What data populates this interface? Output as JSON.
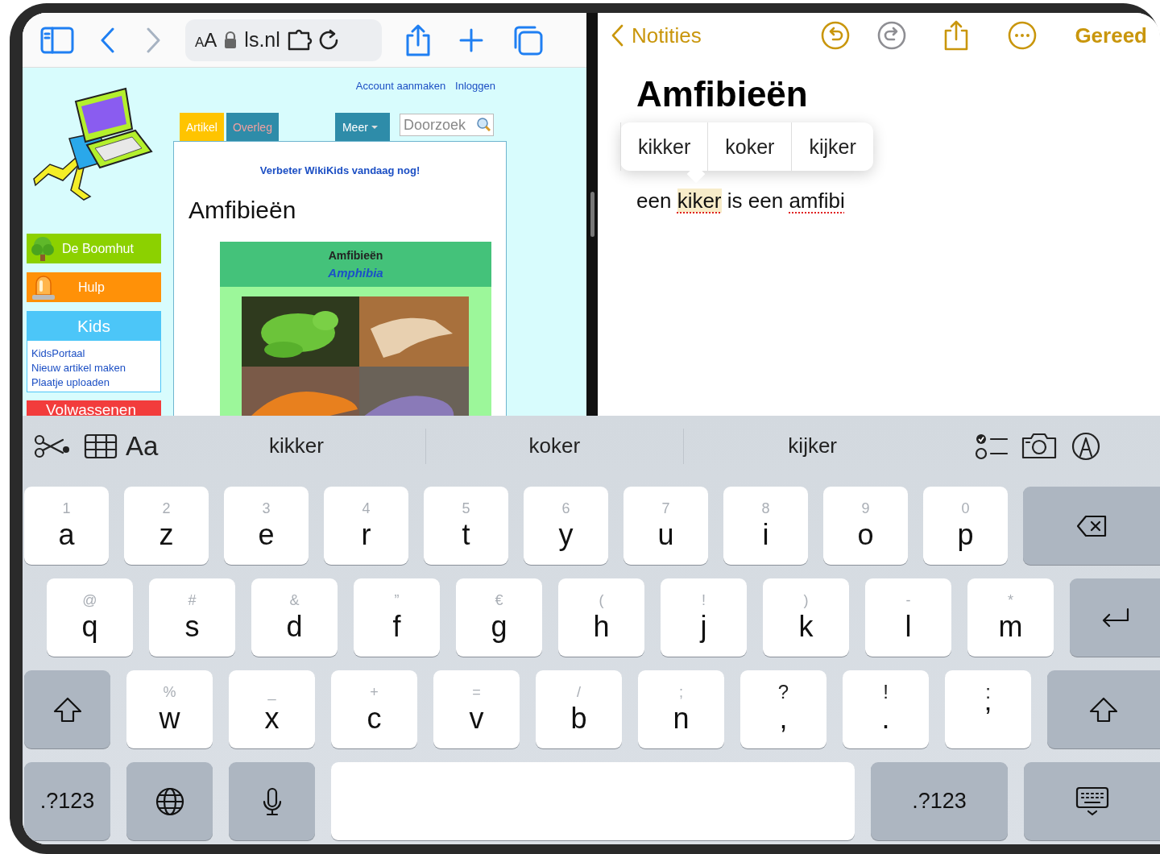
{
  "browser": {
    "toolbar": {
      "back": {
        "disabled": false
      },
      "forward": {
        "disabled": true
      },
      "text_size": "AA",
      "address": "ls.nl"
    },
    "page": {
      "account_links": [
        "Account aanmaken",
        "Inloggen"
      ],
      "tabs": [
        {
          "label": "Artikel",
          "selected": true
        },
        {
          "label": "Overleg",
          "selected": false
        }
      ],
      "more_menu": "Meer",
      "search": {
        "placeholder": "Doorzoek"
      },
      "sidebar": [
        {
          "kind": "button",
          "label": "De Boomhut",
          "color": "#8cd100"
        },
        {
          "kind": "button",
          "label": "Hulp",
          "color": "#ff9108"
        },
        {
          "kind": "box",
          "label": "Kids",
          "color": "#4cc6f8",
          "links": [
            "KidsPortaal",
            "Nieuw artikel maken",
            "Plaatje uploaden"
          ]
        },
        {
          "kind": "button",
          "label": "Volwassenen",
          "color": "#f23c3c"
        }
      ],
      "notice": "Verbeter WikiKids vandaag nog!",
      "heading": "Amfibieën",
      "infobox": {
        "title": "Amfibieën",
        "subtitle": "Amphibia"
      }
    }
  },
  "notes": {
    "back": "Notities",
    "undo": {
      "disabled": false
    },
    "redo": {
      "disabled": true
    },
    "done": "Gereed",
    "title": "Amfibieën",
    "suggestions": [
      "kikker",
      "koker",
      "kijker"
    ],
    "body": [
      {
        "text": "een",
        "misspelled": false,
        "highlighted": false
      },
      {
        "text": "kiker",
        "misspelled": true,
        "highlighted": true
      },
      {
        "text": "is",
        "misspelled": false,
        "highlighted": false
      },
      {
        "text": "een",
        "misspelled": false,
        "highlighted": false
      },
      {
        "text": "amfibi",
        "misspelled": true,
        "highlighted": false
      }
    ]
  },
  "keyboard": {
    "format_button": "Aa",
    "suggestions": [
      "kikker",
      "koker",
      "kijker"
    ],
    "rows": [
      [
        {
          "kind": "letter",
          "label": "a",
          "hint": "1"
        },
        {
          "kind": "letter",
          "label": "z",
          "hint": "2"
        },
        {
          "kind": "letter",
          "label": "e",
          "hint": "3"
        },
        {
          "kind": "letter",
          "label": "r",
          "hint": "4"
        },
        {
          "kind": "letter",
          "label": "t",
          "hint": "5"
        },
        {
          "kind": "letter",
          "label": "y",
          "hint": "6"
        },
        {
          "kind": "letter",
          "label": "u",
          "hint": "7"
        },
        {
          "kind": "letter",
          "label": "i",
          "hint": "8"
        },
        {
          "kind": "letter",
          "label": "o",
          "hint": "9"
        },
        {
          "kind": "letter",
          "label": "p",
          "hint": "0"
        },
        {
          "kind": "delete"
        }
      ],
      [
        {
          "kind": "letter",
          "label": "q",
          "hint": "@"
        },
        {
          "kind": "letter",
          "label": "s",
          "hint": "#"
        },
        {
          "kind": "letter",
          "label": "d",
          "hint": "&"
        },
        {
          "kind": "letter",
          "label": "f",
          "hint": "”"
        },
        {
          "kind": "letter",
          "label": "g",
          "hint": "€"
        },
        {
          "kind": "letter",
          "label": "h",
          "hint": "("
        },
        {
          "kind": "letter",
          "label": "j",
          "hint": "!"
        },
        {
          "kind": "letter",
          "label": "k",
          "hint": ")"
        },
        {
          "kind": "letter",
          "label": "l",
          "hint": "-"
        },
        {
          "kind": "letter",
          "label": "m",
          "hint": "*"
        },
        {
          "kind": "return"
        }
      ],
      [
        {
          "kind": "shift"
        },
        {
          "kind": "letter",
          "label": "w",
          "hint": "%"
        },
        {
          "kind": "letter",
          "label": "x",
          "hint": "_"
        },
        {
          "kind": "letter",
          "label": "c",
          "hint": "+"
        },
        {
          "kind": "letter",
          "label": "v",
          "hint": "="
        },
        {
          "kind": "letter",
          "label": "b",
          "hint": "/"
        },
        {
          "kind": "letter",
          "label": "n",
          "hint": ";"
        },
        {
          "kind": "punct",
          "label": ",",
          "hint": "?"
        },
        {
          "kind": "punct",
          "label": ".",
          "hint": "!"
        },
        {
          "kind": "punct",
          "label": "’",
          "hint": ":"
        },
        {
          "kind": "shift"
        }
      ],
      [
        {
          "kind": "mode",
          "label": ".?123"
        },
        {
          "kind": "globe"
        },
        {
          "kind": "mic"
        },
        {
          "kind": "space"
        },
        {
          "kind": "mode",
          "label": ".?123"
        },
        {
          "kind": "hide"
        }
      ]
    ]
  }
}
